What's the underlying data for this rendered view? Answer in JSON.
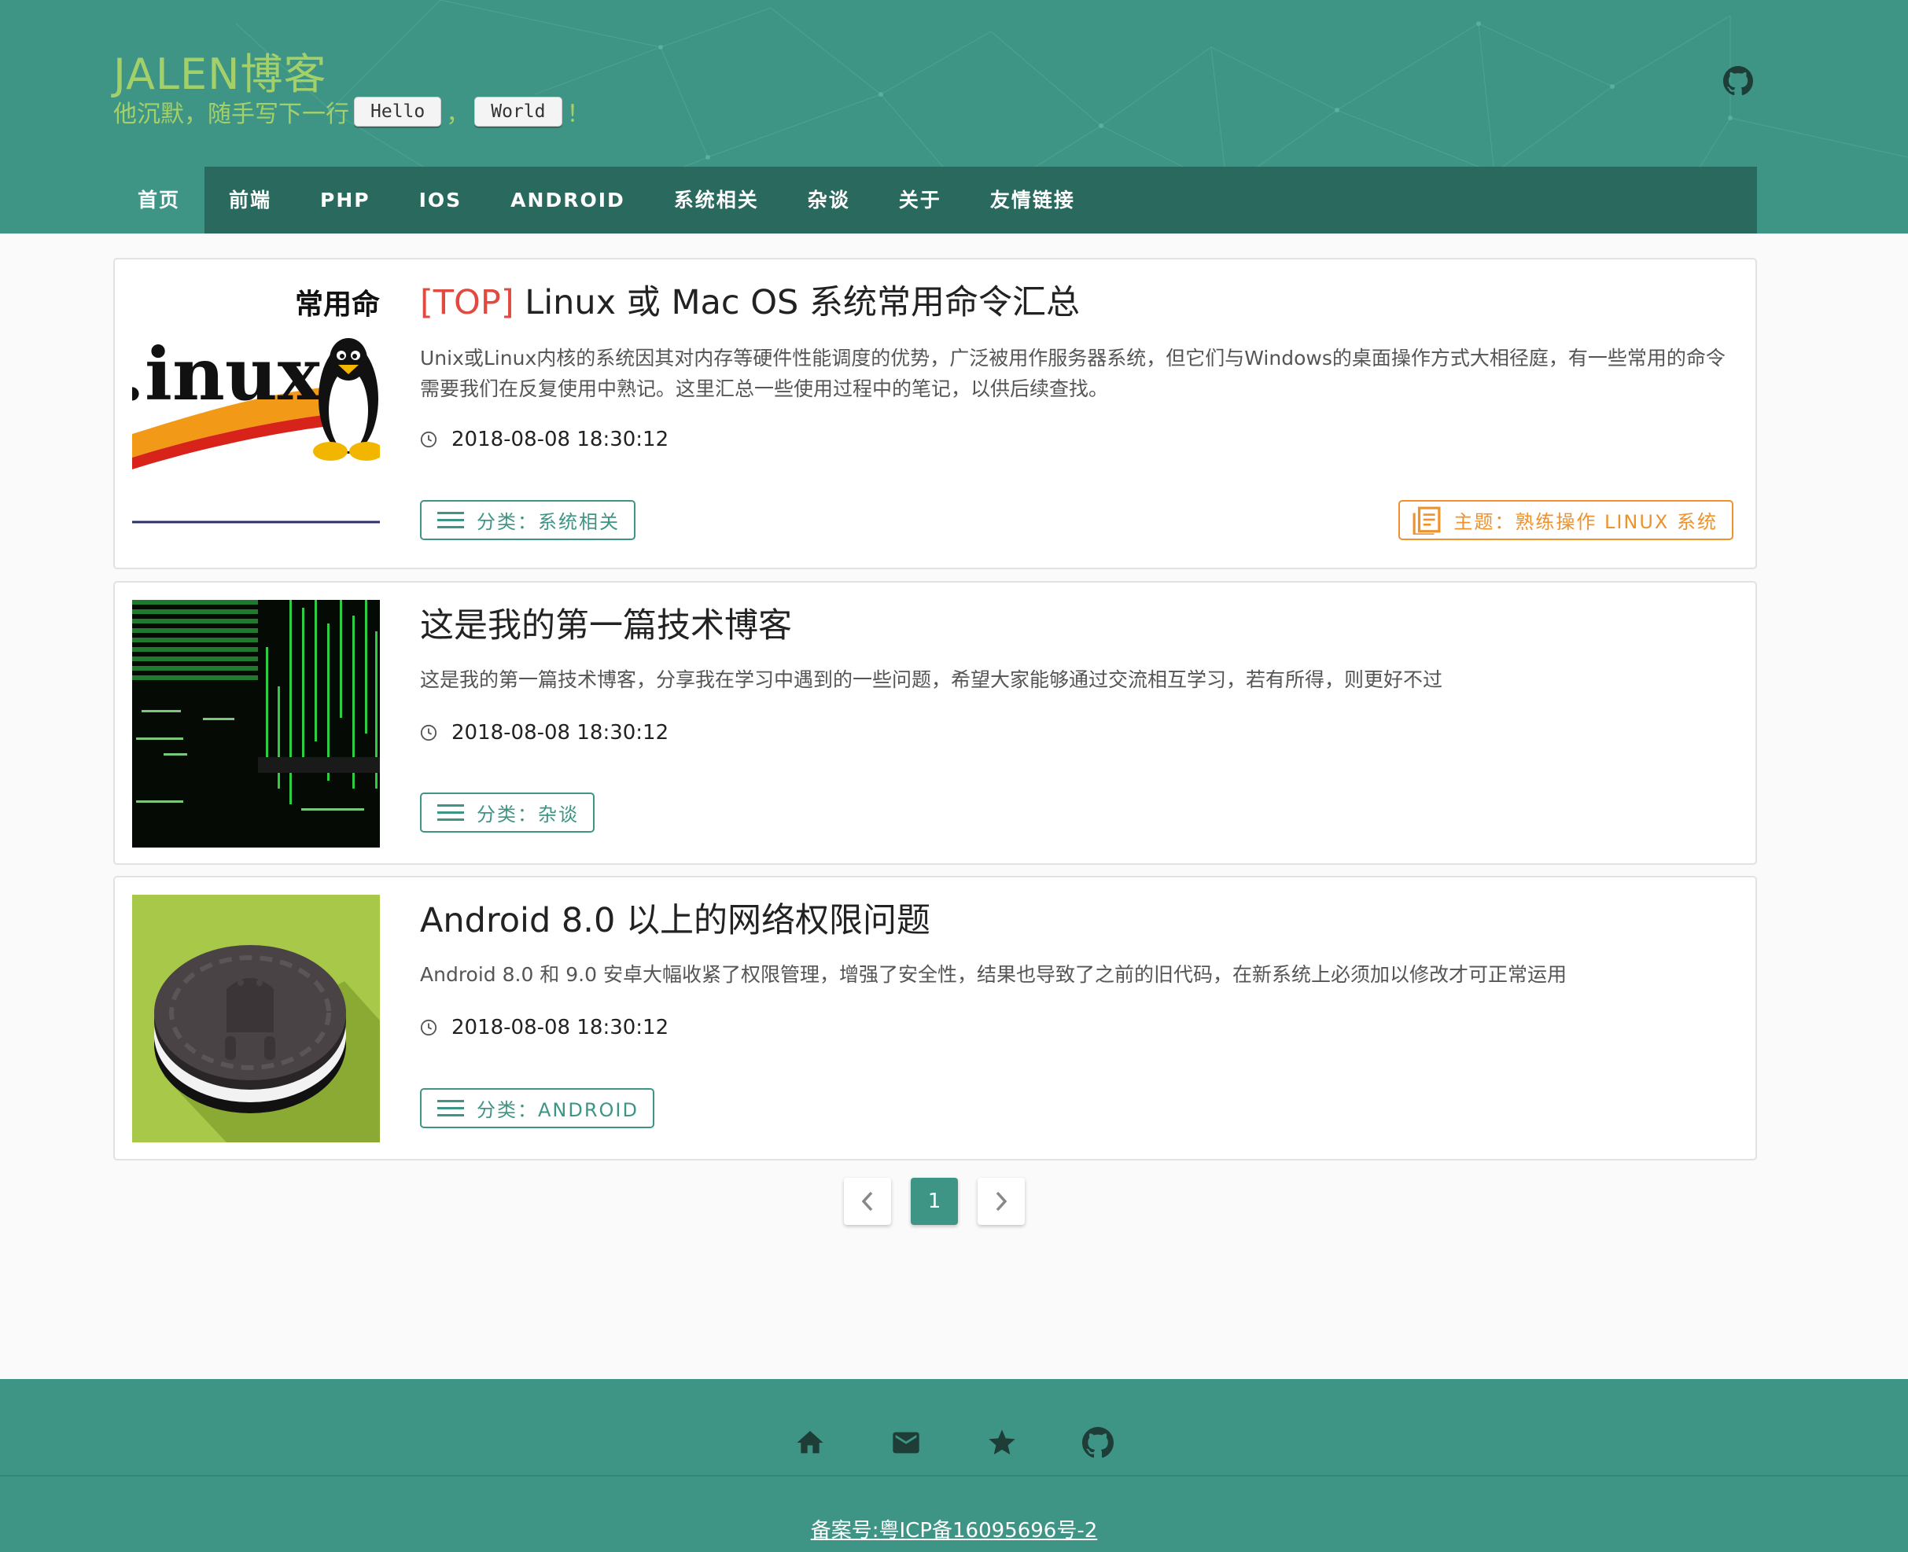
{
  "site": {
    "title": "JALEN博客",
    "subtitle_prefix": "他沉默，随手写下一行",
    "kbd1": "Hello",
    "separator": "，",
    "kbd2": "World",
    "suffix": "！"
  },
  "nav": {
    "items": [
      {
        "label": "首页",
        "active": true
      },
      {
        "label": "前端"
      },
      {
        "label": "PHP"
      },
      {
        "label": "IOS"
      },
      {
        "label": "ANDROID"
      },
      {
        "label": "系统相关"
      },
      {
        "label": "杂谈"
      },
      {
        "label": "关于"
      },
      {
        "label": "友情链接"
      }
    ]
  },
  "posts": [
    {
      "top_marker": "[TOP]",
      "title": " Linux 或 Mac OS 系统常用命令汇总",
      "thumb_text_top": "常用命",
      "thumb_text_main": ".inux",
      "desc": "Unix或Linux内核的系统因其对内存等硬件性能调度的优势，广泛被用作服务器系统，但它们与Windows的桌面操作方式大相径庭，有一些常用的命令需要我们在反复使用中熟记。这里汇总一些使用过程中的笔记，以供后续查找。",
      "date": "2018-08-08 18:30:12",
      "category": "分类：系统相关",
      "topic": "主题：熟练操作 LINUX 系统"
    },
    {
      "title": "这是我的第一篇技术博客",
      "desc": "这是我的第一篇技术博客，分享我在学习中遇到的一些问题，希望大家能够通过交流相互学习，若有所得，则更好不过",
      "date": "2018-08-08 18:30:12",
      "category": "分类：杂谈"
    },
    {
      "title": "Android 8.0 以上的网络权限问题",
      "desc": "Android 8.0 和 9.0 安卓大幅收紧了权限管理，增强了安全性，结果也导致了之前的旧代码，在新系统上必须加以修改才可正常运用",
      "date": "2018-08-08 18:30:12",
      "category": "分类：ANDROID"
    }
  ],
  "pagination": {
    "current": "1",
    "prev_icon": "chevron-left-icon",
    "next_icon": "chevron-right-icon"
  },
  "footer": {
    "icons": [
      "home-icon",
      "mail-icon",
      "star-icon",
      "github-icon"
    ],
    "beian": "备案号:粤ICP备16095696号-2"
  },
  "colors": {
    "primary": "#3e9585",
    "nav_dark": "#2a6a5e",
    "title_green": "#a4d06a",
    "top_red": "#e04a3f",
    "topic_orange": "#f0922c"
  }
}
